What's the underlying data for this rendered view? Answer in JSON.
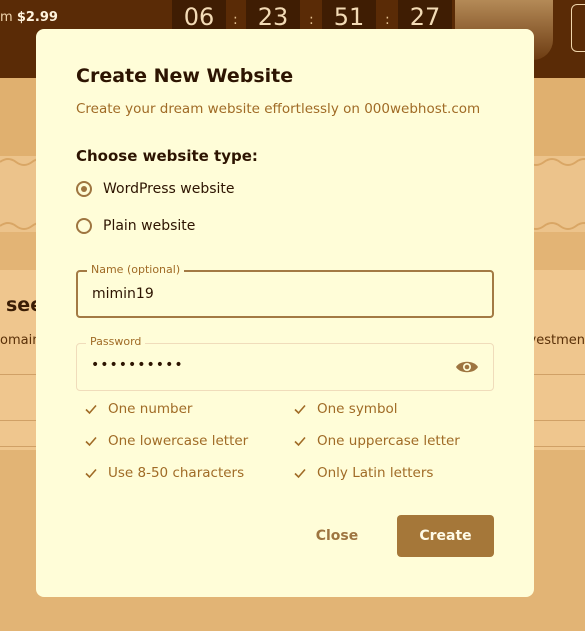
{
  "background": {
    "promo_prefix": "m",
    "promo_price": "$2.99",
    "timer": [
      "06",
      "23",
      "51",
      "27"
    ],
    "timer_separator": ":",
    "heading_fragment": "see",
    "text_left_fragment": "omain",
    "text_right_fragment": "vestmen"
  },
  "modal": {
    "title": "Create New Website",
    "subtitle": "Create your dream website effortlessly on 000webhost.com",
    "type_label": "Choose website type:",
    "options": [
      {
        "label": "WordPress website",
        "checked": true
      },
      {
        "label": "Plain website",
        "checked": false
      }
    ],
    "name_field": {
      "label": "Name (optional)",
      "value": "mimin19"
    },
    "password_field": {
      "label": "Password",
      "value": "••••••••••"
    },
    "rules": [
      "One number",
      "One symbol",
      "One lowercase letter",
      "One uppercase letter",
      "Use 8-50 characters",
      "Only Latin letters"
    ],
    "close_label": "Close",
    "create_label": "Create"
  },
  "colors": {
    "accent": "#a57739",
    "modal_bg": "#fffdd8",
    "topbar_bg": "#5a2b06",
    "text_muted": "#a06b26"
  },
  "icons": {
    "password_toggle": "eye-icon",
    "rule_check": "check-icon"
  }
}
